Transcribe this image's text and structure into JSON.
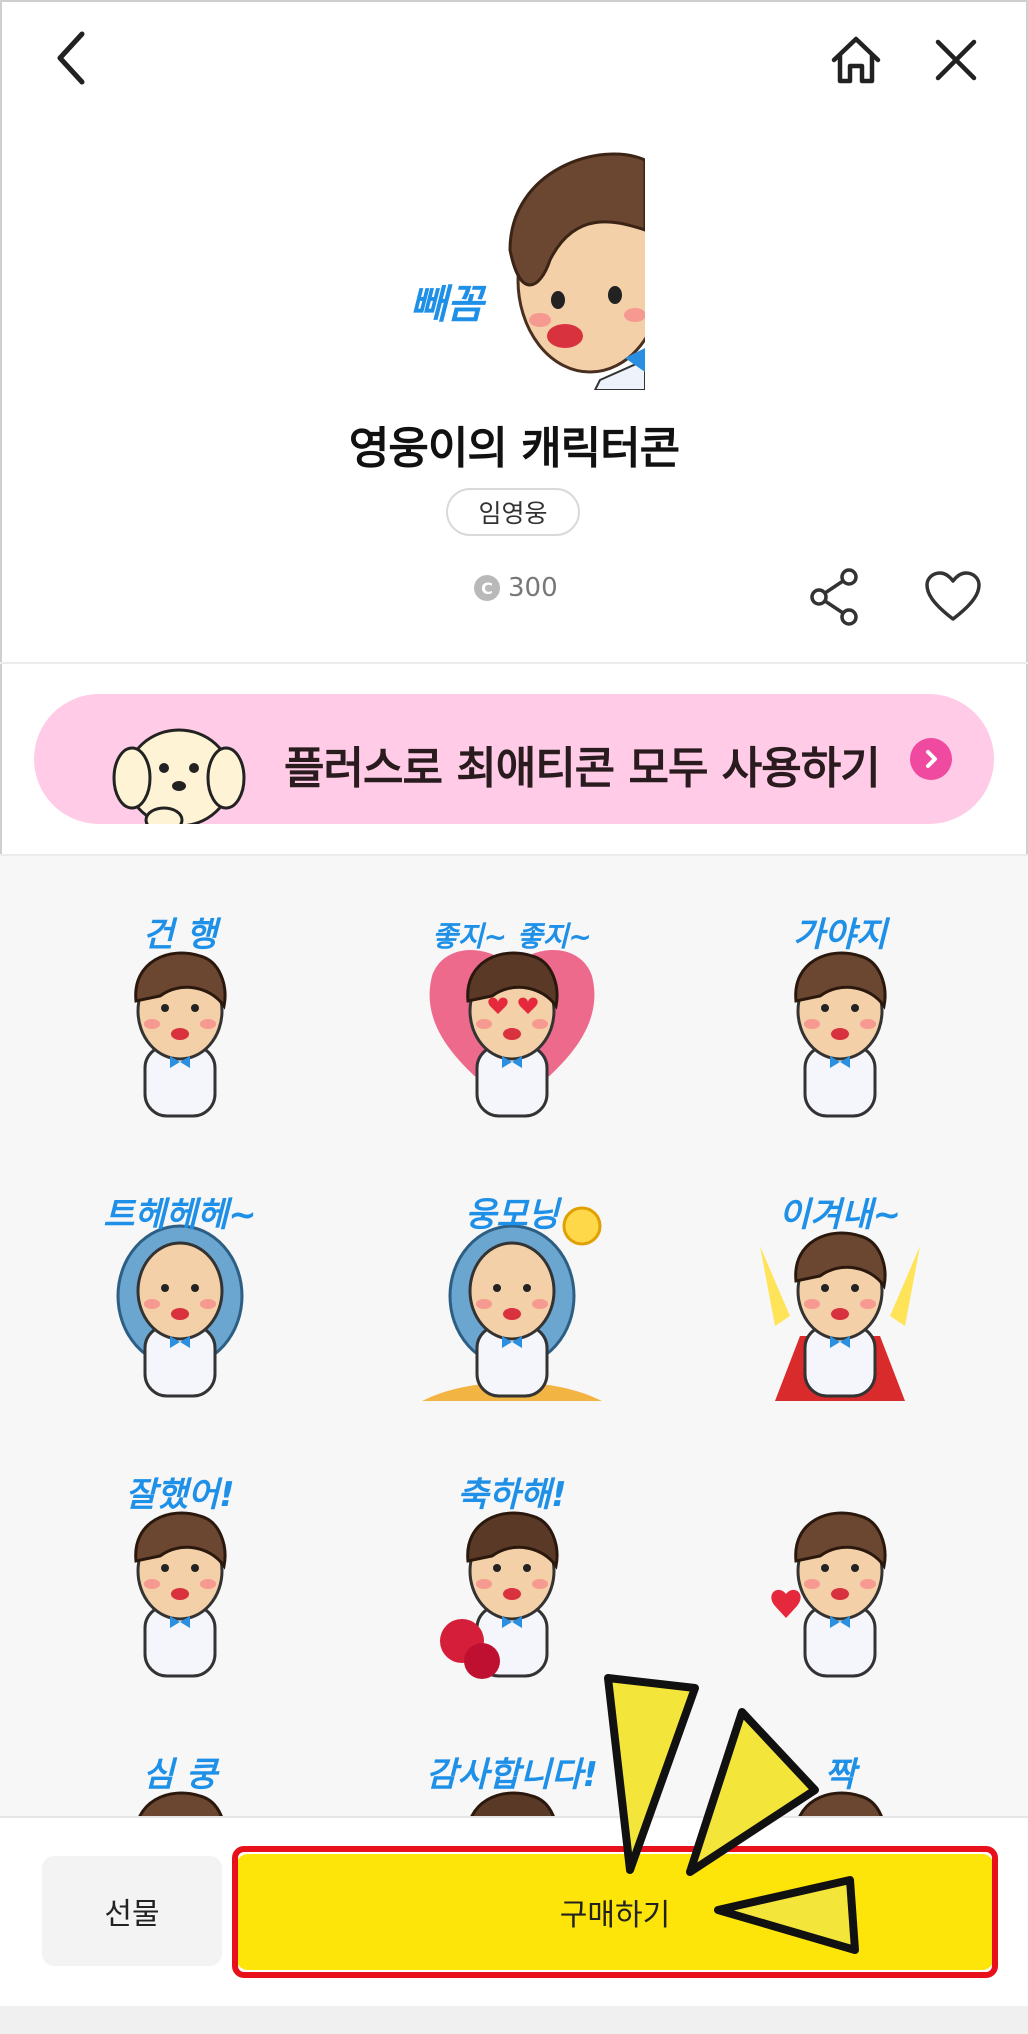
{
  "nav": {
    "back_icon": "chevron-left-icon",
    "home_icon": "home-icon",
    "close_icon": "close-icon"
  },
  "product": {
    "hero_caption": "빼꼼",
    "title": "영웅이의 캐릭터콘",
    "author": "임영웅",
    "price_icon": "C",
    "price": "300",
    "share_icon": "share-icon",
    "like_icon": "heart-icon"
  },
  "promo": {
    "text": "플러스로 최애티콘 모두 사용하기",
    "arrow_icon": "chevron-right-icon"
  },
  "stickers": [
    {
      "caption": "건 행"
    },
    {
      "caption": "좋지~ 좋지~"
    },
    {
      "caption": "가야지"
    },
    {
      "caption": "트헤헤헤~"
    },
    {
      "caption": "웅모닝"
    },
    {
      "caption": "이겨내~"
    },
    {
      "caption": "잘했어!"
    },
    {
      "caption": "축하해!"
    },
    {
      "caption": ""
    },
    {
      "caption": "심 쿵"
    },
    {
      "caption": "감사합니다!"
    },
    {
      "caption": "짝"
    }
  ],
  "actions": {
    "gift_label": "선물",
    "buy_label": "구매하기"
  },
  "colors": {
    "buy": "#fde50a",
    "highlight": "#e8101b",
    "promo_bg": "#ffcbe6",
    "caption": "#1e90e8"
  }
}
